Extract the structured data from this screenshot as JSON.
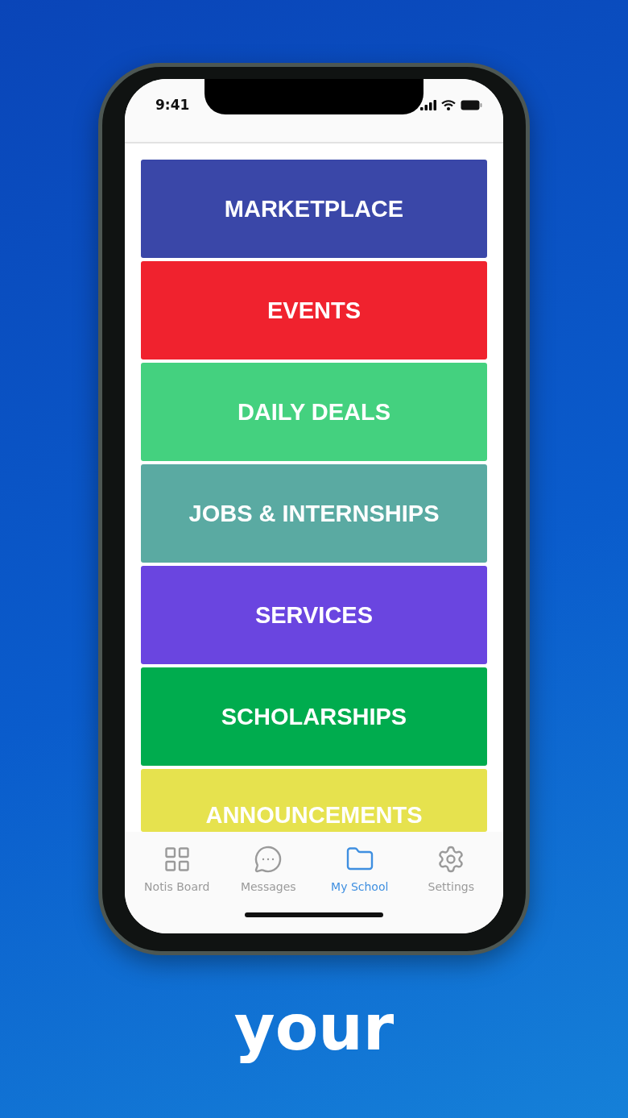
{
  "status_bar": {
    "time": "9:41"
  },
  "categories": [
    {
      "label": "MARKETPLACE",
      "color": "#3a47a8"
    },
    {
      "label": "EVENTS",
      "color": "#f0222e"
    },
    {
      "label": "DAILY DEALS",
      "color": "#44d17f"
    },
    {
      "label": "JOBS & INTERNSHIPS",
      "color": "#5aaaa2"
    },
    {
      "label": "SERVICES",
      "color": "#6a45e0"
    },
    {
      "label": "SCHOLARSHIPS",
      "color": "#00ac4e"
    },
    {
      "label": "ANNOUNCEMENTS",
      "color": "#e6e24e"
    }
  ],
  "tab_bar": [
    {
      "label": "Notis Board",
      "kind": "grid",
      "selected": false
    },
    {
      "label": "Messages",
      "kind": "chat",
      "selected": false
    },
    {
      "label": "My School",
      "kind": "folder",
      "selected": true
    },
    {
      "label": "Settings",
      "kind": "gear",
      "selected": false
    }
  ],
  "caption": "your"
}
